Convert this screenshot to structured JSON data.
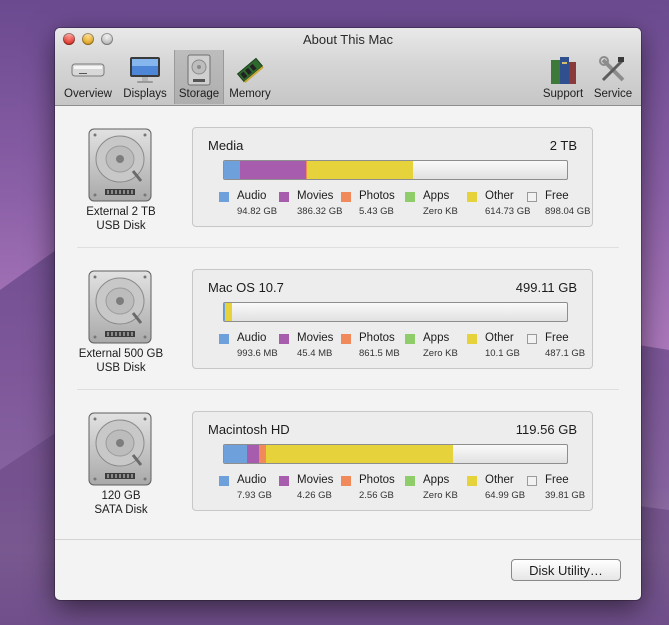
{
  "window": {
    "title": "About This Mac",
    "controls": [
      "close",
      "minimize",
      "zoom"
    ]
  },
  "toolbar": {
    "selected": "Storage",
    "left_items": [
      {
        "label": "Overview",
        "icon": "mac-mini-icon"
      },
      {
        "label": "Displays",
        "icon": "display-icon"
      },
      {
        "label": "Storage",
        "icon": "hard-drive-icon"
      },
      {
        "label": "Memory",
        "icon": "memory-chip-icon"
      }
    ],
    "right_items": [
      {
        "label": "Support",
        "icon": "books-icon"
      },
      {
        "label": "Service",
        "icon": "tools-icon"
      }
    ]
  },
  "legend_colors": {
    "audio": "#6ea0dc",
    "movies": "#a85cae",
    "photos": "#f08a5a",
    "apps": "#8fcc6a",
    "other": "#e6d23a",
    "free": "#f2f2f2"
  },
  "disks": [
    {
      "label_line1": "External 2 TB",
      "label_line2": "USB Disk",
      "volume_name": "Media",
      "volume_size": "2 TB",
      "usage_fractions": {
        "audio": 0.047,
        "movies": 0.193,
        "photos": 0.003,
        "apps": 0.0,
        "other": 0.307,
        "free": 0.45
      },
      "legend": [
        {
          "name": "Audio",
          "value": "94.82 GB"
        },
        {
          "name": "Movies",
          "value": "386.32 GB"
        },
        {
          "name": "Photos",
          "value": "5.43 GB"
        },
        {
          "name": "Apps",
          "value": "Zero KB"
        },
        {
          "name": "Other",
          "value": "614.73 GB"
        },
        {
          "name": "Free",
          "value": "898.04 GB"
        }
      ]
    },
    {
      "label_line1": "External 500 GB",
      "label_line2": "USB Disk",
      "volume_name": "Mac OS 10.7",
      "volume_size": "499.11 GB",
      "usage_fractions": {
        "audio": 0.002,
        "movies": 0.0001,
        "photos": 0.0017,
        "apps": 0.0,
        "other": 0.02,
        "free": 0.976
      },
      "legend": [
        {
          "name": "Audio",
          "value": "993.6 MB"
        },
        {
          "name": "Movies",
          "value": "45.4 MB"
        },
        {
          "name": "Photos",
          "value": "861.5 MB"
        },
        {
          "name": "Apps",
          "value": "Zero KB"
        },
        {
          "name": "Other",
          "value": "10.1 GB"
        },
        {
          "name": "Free",
          "value": "487.1 GB"
        }
      ]
    },
    {
      "label_line1": "120 GB",
      "label_line2": "SATA Disk",
      "volume_name": "Macintosh HD",
      "volume_size": "119.56 GB",
      "usage_fractions": {
        "audio": 0.066,
        "movies": 0.036,
        "photos": 0.021,
        "apps": 0.0,
        "other": 0.544,
        "free": 0.333
      },
      "legend": [
        {
          "name": "Audio",
          "value": "7.93 GB"
        },
        {
          "name": "Movies",
          "value": "4.26 GB"
        },
        {
          "name": "Photos",
          "value": "2.56 GB"
        },
        {
          "name": "Apps",
          "value": "Zero KB"
        },
        {
          "name": "Other",
          "value": "64.99 GB"
        },
        {
          "name": "Free",
          "value": "39.81 GB"
        }
      ]
    }
  ],
  "footer": {
    "disk_utility_label": "Disk Utility…"
  }
}
